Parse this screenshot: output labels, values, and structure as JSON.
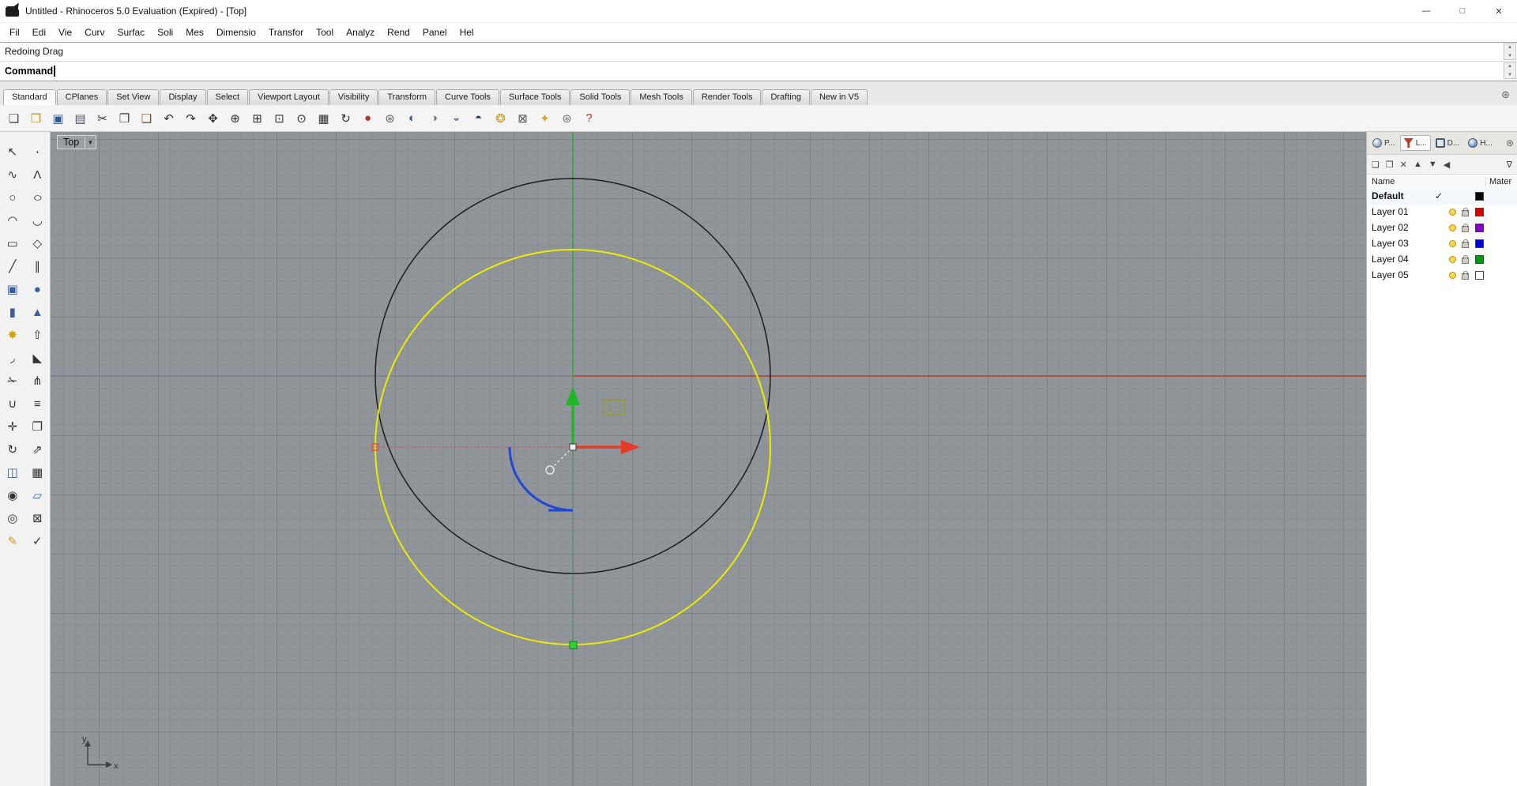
{
  "window": {
    "title": "Untitled - Rhinoceros 5.0 Evaluation (Expired) - [Top]",
    "controls": [
      {
        "name": "minimize-button",
        "glyph": "—"
      },
      {
        "name": "maximize-button",
        "glyph": "□"
      },
      {
        "name": "close-button",
        "glyph": "✕"
      }
    ]
  },
  "menu_bar": {
    "items": [
      {
        "name": "menu-file",
        "label": "Fil"
      },
      {
        "name": "menu-edit",
        "label": "Edi"
      },
      {
        "name": "menu-view",
        "label": "Vie"
      },
      {
        "name": "menu-curve",
        "label": "Curv"
      },
      {
        "name": "menu-surface",
        "label": "Surfac"
      },
      {
        "name": "menu-solid",
        "label": "Soli"
      },
      {
        "name": "menu-mesh",
        "label": "Mes"
      },
      {
        "name": "menu-dimension",
        "label": "Dimensio"
      },
      {
        "name": "menu-transform",
        "label": "Transfor"
      },
      {
        "name": "menu-tools",
        "label": "Tool"
      },
      {
        "name": "menu-analyze",
        "label": "Analyz"
      },
      {
        "name": "menu-render",
        "label": "Rend"
      },
      {
        "name": "menu-panels",
        "label": "Panel"
      },
      {
        "name": "menu-help",
        "label": "Hel"
      }
    ]
  },
  "command_area": {
    "history_line": "Redoing Drag",
    "prompt_label": "Command",
    "scroll_up_glyph": "▲",
    "scroll_down_glyph": "▼"
  },
  "toolbar_tabs": {
    "gear_glyph": "⊛",
    "items": [
      {
        "name": "tab-standard",
        "label": "Standard",
        "active": true
      },
      {
        "name": "tab-cplanes",
        "label": "CPlanes",
        "active": false
      },
      {
        "name": "tab-set-view",
        "label": "Set View",
        "active": false
      },
      {
        "name": "tab-display",
        "label": "Display",
        "active": false
      },
      {
        "name": "tab-select",
        "label": "Select",
        "active": false
      },
      {
        "name": "tab-viewport-layout",
        "label": "Viewport Layout",
        "active": false
      },
      {
        "name": "tab-visibility",
        "label": "Visibility",
        "active": false
      },
      {
        "name": "tab-transform",
        "label": "Transform",
        "active": false
      },
      {
        "name": "tab-curve-tools",
        "label": "Curve Tools",
        "active": false
      },
      {
        "name": "tab-surface-tools",
        "label": "Surface Tools",
        "active": false
      },
      {
        "name": "tab-solid-tools",
        "label": "Solid Tools",
        "active": false
      },
      {
        "name": "tab-mesh-tools",
        "label": "Mesh Tools",
        "active": false
      },
      {
        "name": "tab-render-tools",
        "label": "Render Tools",
        "active": false
      },
      {
        "name": "tab-drafting",
        "label": "Drafting",
        "active": false
      },
      {
        "name": "tab-new-in-v5",
        "label": "New in V5",
        "active": false
      }
    ]
  },
  "standard_toolbar": {
    "icons": [
      {
        "name": "new-file-icon",
        "glyph": "❏",
        "color": "#445"
      },
      {
        "name": "open-file-icon",
        "glyph": "❒",
        "color": "#b8912f"
      },
      {
        "name": "save-icon",
        "glyph": "▣",
        "color": "#35588f"
      },
      {
        "name": "print-icon",
        "glyph": "▤",
        "color": "#556"
      },
      {
        "name": "cut-icon",
        "glyph": "✂",
        "color": "#333"
      },
      {
        "name": "copy-icon",
        "glyph": "❐",
        "color": "#445"
      },
      {
        "name": "paste-icon",
        "glyph": "❑",
        "color": "#6b4e2e"
      },
      {
        "name": "undo-icon",
        "glyph": "↶",
        "color": "#333"
      },
      {
        "name": "redo-icon",
        "glyph": "↷",
        "color": "#333"
      },
      {
        "name": "pan-icon",
        "glyph": "✥",
        "color": "#333"
      },
      {
        "name": "zoom-dynamic-icon",
        "glyph": "⊕",
        "color": "#333"
      },
      {
        "name": "zoom-window-icon",
        "glyph": "⊞",
        "color": "#333"
      },
      {
        "name": "zoom-extents-icon",
        "glyph": "⊡",
        "color": "#333"
      },
      {
        "name": "zoom-selected-icon",
        "glyph": "⊙",
        "color": "#333"
      },
      {
        "name": "viewport-layout-icon",
        "glyph": "▦",
        "color": "#333"
      },
      {
        "name": "rotate-view-icon",
        "glyph": "↻",
        "color": "#333"
      },
      {
        "name": "render-icon",
        "glyph": "●",
        "color": "#b5372a"
      },
      {
        "name": "render-options-icon",
        "glyph": "⊛",
        "color": "#666"
      },
      {
        "name": "shaded-viewport-icon",
        "glyph": "◐",
        "color": "#3b5b8c"
      },
      {
        "name": "ghosted-viewport-icon",
        "glyph": "◑",
        "color": "#6a7a8a"
      },
      {
        "name": "xray-viewport-icon",
        "glyph": "◒",
        "color": "#7c8796"
      },
      {
        "name": "rendered-viewport-icon",
        "glyph": "◓",
        "color": "#2c3e60"
      },
      {
        "name": "lightbulb-icon",
        "glyph": "❂",
        "color": "#c2a21a"
      },
      {
        "name": "lock-icon",
        "glyph": "⊠",
        "color": "#555"
      },
      {
        "name": "gumball-toggle-icon",
        "glyph": "✦",
        "color": "#d7a51f"
      },
      {
        "name": "options-gear-icon",
        "glyph": "⊛",
        "color": "#777"
      },
      {
        "name": "help-icon",
        "glyph": "?",
        "color": "#b03030"
      }
    ]
  },
  "tool_sidebar": {
    "tools": [
      {
        "name": "sidebar-tool-select",
        "glyph": "↖",
        "color": "#333"
      },
      {
        "name": "sidebar-tool-point",
        "glyph": "∙",
        "color": "#333"
      },
      {
        "name": "sidebar-tool-curve",
        "glyph": "∿",
        "color": "#333"
      },
      {
        "name": "sidebar-tool-polyline",
        "glyph": "Λ",
        "color": "#333"
      },
      {
        "name": "sidebar-tool-circle",
        "glyph": "○",
        "color": "#333"
      },
      {
        "name": "sidebar-tool-ellipse",
        "glyph": "○",
        "color": "#333"
      },
      {
        "name": "sidebar-tool-arc",
        "glyph": "◠",
        "color": "#333"
      },
      {
        "name": "sidebar-tool-curve-through-points",
        "glyph": "◡",
        "color": "#333"
      },
      {
        "name": "sidebar-tool-rectangle",
        "glyph": "▭",
        "color": "#333"
      },
      {
        "name": "sidebar-tool-polygon",
        "glyph": "◇",
        "color": "#333"
      },
      {
        "name": "sidebar-tool-line",
        "glyph": "╱",
        "color": "#333"
      },
      {
        "name": "sidebar-tool-offset",
        "glyph": "∥",
        "color": "#333"
      },
      {
        "name": "sidebar-tool-box",
        "glyph": "▣",
        "color": "#3a5f9e"
      },
      {
        "name": "sidebar-tool-sphere",
        "glyph": "●",
        "color": "#3a5f9e"
      },
      {
        "name": "sidebar-tool-cylinder",
        "glyph": "▮",
        "color": "#3a5f9e"
      },
      {
        "name": "sidebar-tool-cone",
        "glyph": "▲",
        "color": "#3a5f9e"
      },
      {
        "name": "sidebar-tool-explode",
        "glyph": "✸",
        "color": "#d7a00f"
      },
      {
        "name": "sidebar-tool-extrude",
        "glyph": "⇧",
        "color": "#333"
      },
      {
        "name": "sidebar-tool-fillet",
        "glyph": "◞",
        "color": "#333"
      },
      {
        "name": "sidebar-tool-chamfer",
        "glyph": "◣",
        "color": "#333"
      },
      {
        "name": "sidebar-tool-trim",
        "glyph": "✁",
        "color": "#333"
      },
      {
        "name": "sidebar-tool-split",
        "glyph": "⋔",
        "color": "#333"
      },
      {
        "name": "sidebar-tool-join",
        "glyph": "∪",
        "color": "#333"
      },
      {
        "name": "sidebar-tool-group",
        "glyph": "≡",
        "color": "#333"
      },
      {
        "name": "sidebar-tool-move",
        "glyph": "✛",
        "color": "#333"
      },
      {
        "name": "sidebar-tool-copy",
        "glyph": "❐",
        "color": "#333"
      },
      {
        "name": "sidebar-tool-rotate",
        "glyph": "↻",
        "color": "#333"
      },
      {
        "name": "sidebar-tool-scale",
        "glyph": "⇗",
        "color": "#333"
      },
      {
        "name": "sidebar-tool-mirror",
        "glyph": "◫",
        "color": "#3a5f9e"
      },
      {
        "name": "sidebar-tool-array",
        "glyph": "▦",
        "color": "#333"
      },
      {
        "name": "sidebar-tool-curve-boolean",
        "glyph": "◉",
        "color": "#333"
      },
      {
        "name": "sidebar-tool-surface",
        "glyph": "▱",
        "color": "#3a5f9e"
      },
      {
        "name": "sidebar-tool-visibility",
        "glyph": "◎",
        "color": "#333"
      },
      {
        "name": "sidebar-tool-lock",
        "glyph": "⊠",
        "color": "#333"
      },
      {
        "name": "sidebar-tool-annotate",
        "glyph": "✎",
        "color": "#c99c1e"
      },
      {
        "name": "sidebar-tool-check",
        "glyph": "✓",
        "color": "#333"
      }
    ]
  },
  "viewport": {
    "label": "Top",
    "dropdown_glyph": "▾",
    "axis_x_label": "x",
    "axis_y_label": "y",
    "colors": {
      "selected": "#ecec00",
      "curve": "#1c1c1c",
      "x_axis": "#b5432f",
      "y_axis": "#3da23d",
      "gumball_green": "#22b32b",
      "gumball_red": "#e23c28",
      "gumball_blue": "#2247d0",
      "tracking": "#e05548",
      "grid_widget": "#98982c"
    }
  },
  "layers_panel": {
    "gear_glyph": "⊛",
    "tabs": [
      {
        "name": "panel-tab-properties",
        "icon": "properties",
        "icon_name": "properties-icon",
        "label": "P...",
        "active": false
      },
      {
        "name": "panel-tab-layers",
        "icon": "layers",
        "icon_name": "layers-icon",
        "label": "L...",
        "active": true
      },
      {
        "name": "panel-tab-display",
        "icon": "display",
        "icon_name": "display-icon",
        "label": "D...",
        "active": false
      },
      {
        "name": "panel-tab-help",
        "icon": "help",
        "icon_name": "help-icon",
        "label": "H...",
        "active": false
      }
    ],
    "toolbar": [
      {
        "name": "new-layer-icon",
        "glyph": "❏"
      },
      {
        "name": "copy-layer-icon",
        "glyph": "❐"
      },
      {
        "name": "delete-layer-icon",
        "glyph": "✕"
      },
      {
        "name": "move-layer-up-icon",
        "glyph": "▲"
      },
      {
        "name": "move-layer-down-icon",
        "glyph": "▼"
      },
      {
        "name": "collapse-layers-icon",
        "glyph": "◀"
      },
      {
        "name": "filter-layers-icon",
        "glyph": "∇"
      }
    ],
    "header": {
      "name_label": "Name",
      "material_label": "Mater"
    },
    "rows": [
      {
        "row_name": "layer-row-default",
        "name": "Default",
        "check": "✓",
        "current": true,
        "lamp": false,
        "lock": false,
        "color": "#000000"
      },
      {
        "row_name": "layer-row-01",
        "name": "Layer 01",
        "check": "",
        "current": false,
        "lamp": true,
        "lock": true,
        "color": "#d40000"
      },
      {
        "row_name": "layer-row-02",
        "name": "Layer 02",
        "check": "",
        "current": false,
        "lamp": true,
        "lock": true,
        "color": "#8000c0"
      },
      {
        "row_name": "layer-row-03",
        "name": "Layer 03",
        "check": "",
        "current": false,
        "lamp": true,
        "lock": true,
        "color": "#0000d0"
      },
      {
        "row_name": "layer-row-04",
        "name": "Layer 04",
        "check": "",
        "current": false,
        "lamp": true,
        "lock": true,
        "color": "#009614"
      },
      {
        "row_name": "layer-row-05",
        "name": "Layer 05",
        "check": "",
        "current": false,
        "lamp": true,
        "lock": true,
        "color": "#ffffff"
      }
    ]
  }
}
